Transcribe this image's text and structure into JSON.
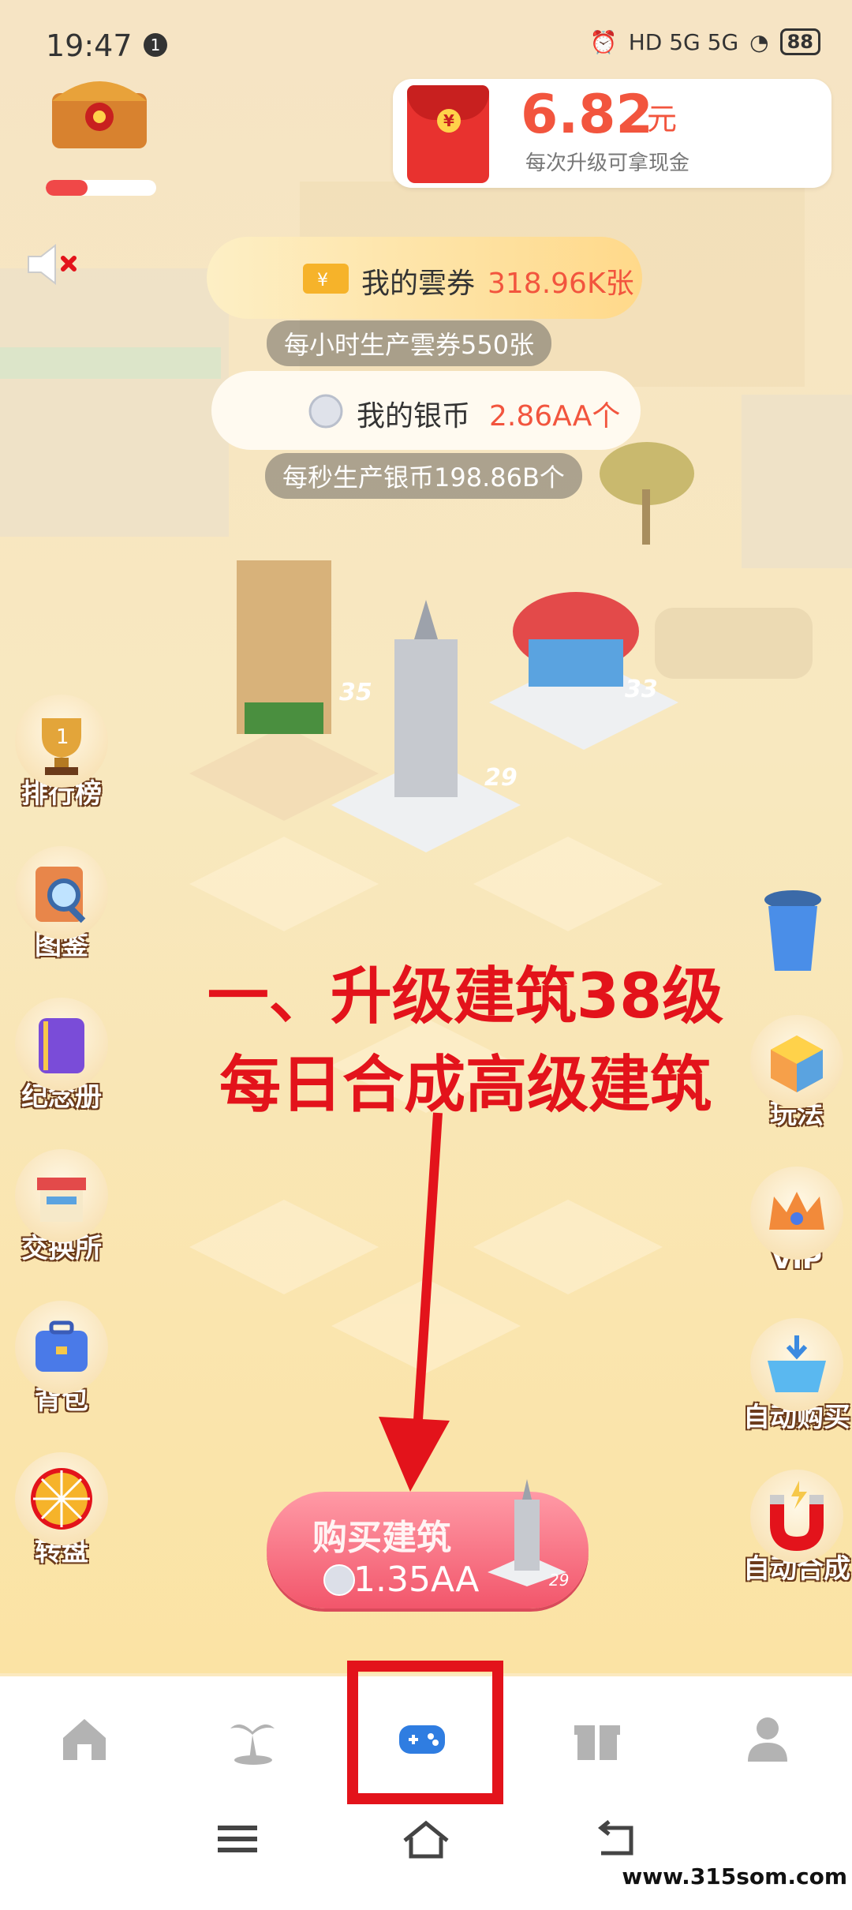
{
  "status_bar": {
    "time": "19:47",
    "notif_count": "1",
    "network": "HD 5G 5G",
    "battery": "88"
  },
  "cash_card": {
    "amount": "6.82",
    "unit": "元",
    "desc": "每次升级可拿现金"
  },
  "tickets": {
    "label": "我的雲券",
    "value": "318.96K张",
    "rate": "每小时生产雲券550张"
  },
  "silver": {
    "label": "我的银币",
    "value": "2.86AA个",
    "rate": "每秒生产银币198.86B个"
  },
  "buildings": {
    "levels": [
      "35",
      "29",
      "33"
    ]
  },
  "left_menu": [
    {
      "label": "排行榜",
      "icon": "trophy-icon"
    },
    {
      "label": "图鉴",
      "icon": "magnifier-icon"
    },
    {
      "label": "纪念册",
      "icon": "album-icon"
    },
    {
      "label": "交换所",
      "icon": "shop-icon"
    },
    {
      "label": "背包",
      "icon": "backpack-icon"
    },
    {
      "label": "转盘",
      "icon": "wheel-icon"
    }
  ],
  "right_menu": [
    {
      "label": "玩法",
      "icon": "cube-icon"
    },
    {
      "label": "VIP",
      "icon": "crown-icon"
    },
    {
      "label": "自动购买",
      "icon": "basket-icon"
    },
    {
      "label": "自动合成",
      "icon": "magnet-icon"
    }
  ],
  "overlay": {
    "line1": "一、升级建筑38级",
    "line2": "每日合成高级建筑"
  },
  "buy_button": {
    "title": "购买建筑",
    "cost": "1.35AA",
    "building_level": "29"
  },
  "bottom_nav": [
    "home-icon",
    "island-icon",
    "gamepad-icon",
    "gift-icon",
    "profile-icon"
  ],
  "watermark": "www.315som.com",
  "colors": {
    "accent_red": "#e3131b",
    "value_orange": "#f2553e",
    "nav_active": "#2f7de1"
  }
}
